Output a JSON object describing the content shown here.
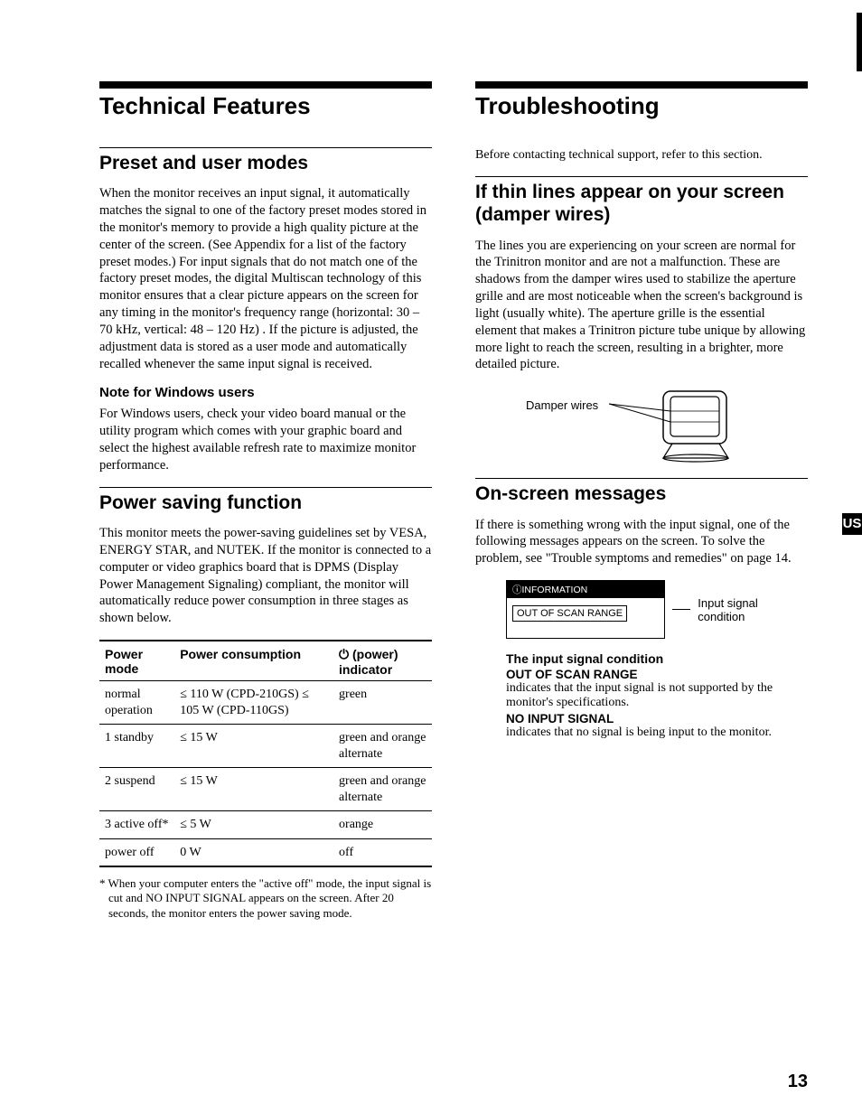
{
  "left": {
    "main_heading": "Technical Features",
    "sec1_heading": "Preset and user modes",
    "sec1_p1": "When the monitor receives an input signal, it automatically matches the signal to one of the factory preset modes stored in the monitor's memory to provide a high quality picture at the center of the screen. (See Appendix for a list of the factory preset modes.) For input signals that do not match one of the factory preset modes, the digital Multiscan technology of this monitor ensures that a clear picture appears on the screen for any timing in the monitor's frequency range (horizontal: 30 – 70 kHz, vertical: 48 – 120 Hz) . If the picture is adjusted, the adjustment data is stored as a user mode and automatically recalled whenever the same input signal is received.",
    "sec1_note_heading": "Note for Windows users",
    "sec1_note_p": "For Windows users, check your video board manual or the utility program which comes with your graphic board and select the highest available refresh rate to maximize monitor performance.",
    "sec2_heading": "Power saving function",
    "sec2_p1": "This monitor meets the power-saving guidelines set by VESA, ENERGY STAR, and NUTEK. If the monitor is connected to a computer or video graphics board that is DPMS (Display Power Management Signaling) compliant, the monitor will automatically reduce power consumption in three stages as shown below.",
    "table": {
      "headers": [
        "Power mode",
        "Power consumption",
        "⏻ (power) indicator"
      ],
      "rows": [
        [
          "normal operation",
          "≤ 110 W (CPD-210GS) ≤ 105 W (CPD-110GS)",
          "green"
        ],
        [
          "1 standby",
          "≤ 15 W",
          "green and orange alternate"
        ],
        [
          "2 suspend",
          "≤ 15 W",
          "green and orange alternate"
        ],
        [
          "3 active off*",
          "≤ 5 W",
          "orange"
        ],
        [
          "power off",
          "0 W",
          "off"
        ]
      ]
    },
    "footnote": "* When your computer enters the \"active off\" mode, the input signal is cut and NO INPUT SIGNAL appears on the screen. After 20 seconds, the monitor enters the power saving mode."
  },
  "right": {
    "main_heading": "Troubleshooting",
    "intro": "Before contacting technical support, refer to this section.",
    "sec1_heading": "If thin lines appear on your screen (damper wires)",
    "sec1_p1": "The lines you are experiencing on your screen are normal for the Trinitron monitor and are not a malfunction. These are shadows from the damper wires used to stabilize the aperture grille and are most noticeable when the screen's background is light (usually white). The aperture grille is the essential element that makes a Trinitron picture tube unique by allowing more light to reach the screen, resulting in a brighter, more detailed picture.",
    "damper_label": "Damper wires",
    "sec2_heading": "On-screen messages",
    "sec2_p1": "If there is something wrong with the input signal, one of the following messages appears on the screen. To solve the problem, see \"Trouble symptoms and remedies\" on page 14.",
    "osd_title": "ⓘINFORMATION",
    "osd_body": "OUT OF SCAN RANGE",
    "osd_caption": "Input signal condition",
    "cond_heading": "The input signal condition",
    "cond1_label": "OUT OF SCAN RANGE",
    "cond1_text": "indicates that the input signal is not supported by the monitor's specifications.",
    "cond2_label": "NO INPUT SIGNAL",
    "cond2_text": "indicates that no signal is being input to the monitor."
  },
  "page_number": "13",
  "side_tab": "US"
}
